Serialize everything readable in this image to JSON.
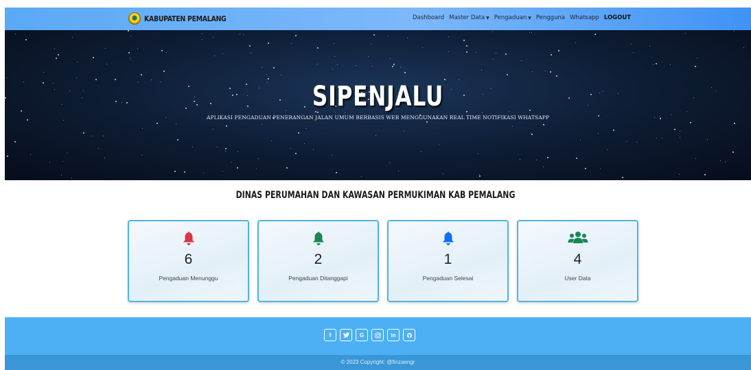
{
  "navbar": {
    "brand": "KABUPATEN PEMALANG",
    "links": {
      "dashboard": "Dashboard",
      "master_data": "Master Data",
      "pengaduan": "Pengaduan",
      "pengguna": "Pengguna",
      "whatsapp": "Whatsapp",
      "logout": "LOGOUT"
    }
  },
  "hero": {
    "title": "SIPENJALU",
    "subtitle": "APLIKASI PENGADUAN PENERANGAN JALAN UMUM BERBASIS WEB MENGGUNAKAN REAL TIME NOTIFIKASI WHATSAPP"
  },
  "section_title": "DINAS PERUMAHAN DAN KAWASAN PERMUKIMAN KAB PEMALANG",
  "cards": [
    {
      "count": "6",
      "label": "Pengaduan Menunggu",
      "icon": "bell-icon",
      "color": "#dc3545"
    },
    {
      "count": "2",
      "label": "Pengaduan Ditanggapi",
      "icon": "bell-icon",
      "color": "#198754"
    },
    {
      "count": "1",
      "label": "Pengaduan Selesai",
      "icon": "bell-icon",
      "color": "#0d6efd"
    },
    {
      "count": "4",
      "label": "User Data",
      "icon": "users-icon",
      "color": "#198754"
    }
  ],
  "footer": {
    "socials": [
      {
        "icon": "facebook-icon",
        "glyph": "f"
      },
      {
        "icon": "twitter-icon",
        "glyph": "🐦"
      },
      {
        "icon": "google-icon",
        "glyph": "G"
      },
      {
        "icon": "instagram-icon",
        "glyph": "◎"
      },
      {
        "icon": "linkedin-icon",
        "glyph": "in"
      },
      {
        "icon": "github-icon",
        "glyph": "◐"
      }
    ],
    "copyright": "© 2023 Copyright: @finzaengr"
  }
}
